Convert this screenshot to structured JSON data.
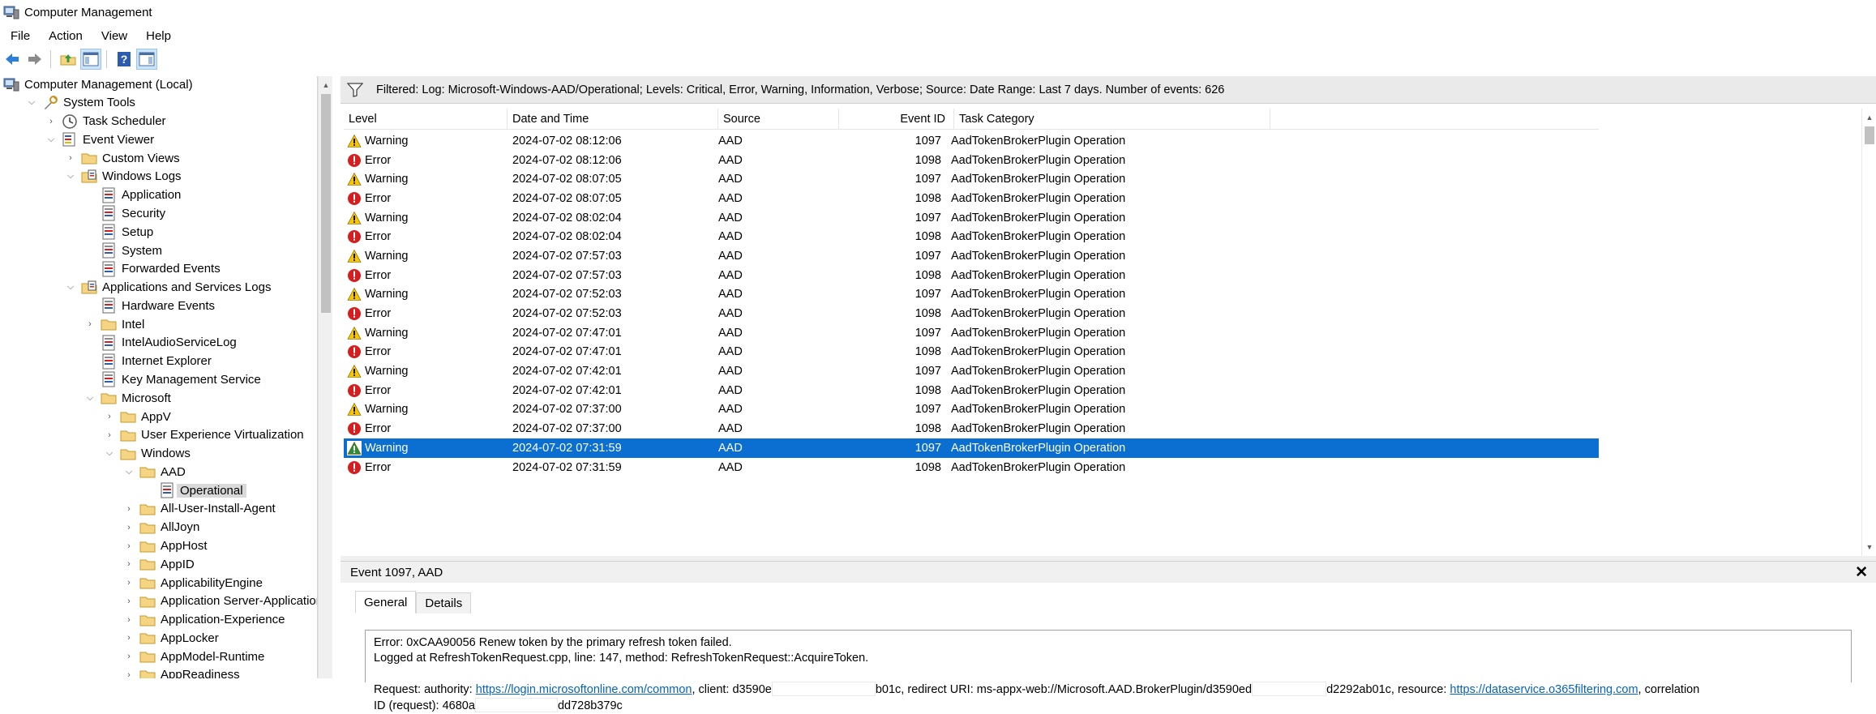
{
  "window": {
    "title": "Computer Management"
  },
  "menu": [
    "File",
    "Action",
    "View",
    "Help"
  ],
  "tree": {
    "items": [
      {
        "label": "Computer Management (Local)",
        "icon": "computer-icon",
        "depth": 0,
        "expander": ""
      },
      {
        "label": "System Tools",
        "icon": "tools-icon",
        "depth": 1,
        "expander": "open"
      },
      {
        "label": "Task Scheduler",
        "icon": "clock-icon",
        "depth": 2,
        "expander": "closed"
      },
      {
        "label": "Event Viewer",
        "icon": "event-viewer-icon",
        "depth": 2,
        "expander": "open"
      },
      {
        "label": "Custom Views",
        "icon": "folder-icon",
        "depth": 3,
        "expander": "closed"
      },
      {
        "label": "Windows Logs",
        "icon": "folder-log-icon",
        "depth": 3,
        "expander": "open"
      },
      {
        "label": "Application",
        "icon": "log-icon",
        "depth": 4,
        "expander": ""
      },
      {
        "label": "Security",
        "icon": "log-icon",
        "depth": 4,
        "expander": ""
      },
      {
        "label": "Setup",
        "icon": "log-icon",
        "depth": 4,
        "expander": ""
      },
      {
        "label": "System",
        "icon": "log-icon",
        "depth": 4,
        "expander": ""
      },
      {
        "label": "Forwarded Events",
        "icon": "log-icon",
        "depth": 4,
        "expander": ""
      },
      {
        "label": "Applications and Services Logs",
        "icon": "folder-log-icon",
        "depth": 3,
        "expander": "open"
      },
      {
        "label": "Hardware Events",
        "icon": "log-icon",
        "depth": 4,
        "expander": ""
      },
      {
        "label": "Intel",
        "icon": "folder-icon",
        "depth": 4,
        "expander": "closed"
      },
      {
        "label": "IntelAudioServiceLog",
        "icon": "log-icon",
        "depth": 4,
        "expander": ""
      },
      {
        "label": "Internet Explorer",
        "icon": "log-icon",
        "depth": 4,
        "expander": ""
      },
      {
        "label": "Key Management Service",
        "icon": "log-icon",
        "depth": 4,
        "expander": ""
      },
      {
        "label": "Microsoft",
        "icon": "folder-icon",
        "depth": 4,
        "expander": "open"
      },
      {
        "label": "AppV",
        "icon": "folder-icon",
        "depth": 5,
        "expander": "closed"
      },
      {
        "label": "User Experience Virtualization",
        "icon": "folder-icon",
        "depth": 5,
        "expander": "closed"
      },
      {
        "label": "Windows",
        "icon": "folder-icon",
        "depth": 5,
        "expander": "open"
      },
      {
        "label": "AAD",
        "icon": "folder-icon",
        "depth": 6,
        "expander": "open"
      },
      {
        "label": "Operational",
        "icon": "log-icon",
        "depth": 7,
        "expander": "",
        "selected": true
      },
      {
        "label": "All-User-Install-Agent",
        "icon": "folder-icon",
        "depth": 6,
        "expander": "closed"
      },
      {
        "label": "AllJoyn",
        "icon": "folder-icon",
        "depth": 6,
        "expander": "closed"
      },
      {
        "label": "AppHost",
        "icon": "folder-icon",
        "depth": 6,
        "expander": "closed"
      },
      {
        "label": "AppID",
        "icon": "folder-icon",
        "depth": 6,
        "expander": "closed"
      },
      {
        "label": "ApplicabilityEngine",
        "icon": "folder-icon",
        "depth": 6,
        "expander": "closed"
      },
      {
        "label": "Application Server-Applications",
        "icon": "folder-icon",
        "depth": 6,
        "expander": "closed"
      },
      {
        "label": "Application-Experience",
        "icon": "folder-icon",
        "depth": 6,
        "expander": "closed"
      },
      {
        "label": "AppLocker",
        "icon": "folder-icon",
        "depth": 6,
        "expander": "closed"
      },
      {
        "label": "AppModel-Runtime",
        "icon": "folder-icon",
        "depth": 6,
        "expander": "closed"
      },
      {
        "label": "AppReadiness",
        "icon": "folder-icon",
        "depth": 6,
        "expander": "closed"
      }
    ]
  },
  "filter": {
    "text": "Filtered: Log: Microsoft-Windows-AAD/Operational; Levels: Critical, Error, Warning, Information, Verbose; Source: Date Range: Last 7 days. Number of events: 626"
  },
  "events": {
    "columns": [
      "Level",
      "Date and Time",
      "Source",
      "Event ID",
      "Task Category"
    ],
    "rows": [
      {
        "level": "Warning",
        "date": "2024-07-02 08:12:06",
        "source": "AAD",
        "id": "1097",
        "category": "AadTokenBrokerPlugin Operation"
      },
      {
        "level": "Error",
        "date": "2024-07-02 08:12:06",
        "source": "AAD",
        "id": "1098",
        "category": "AadTokenBrokerPlugin Operation"
      },
      {
        "level": "Warning",
        "date": "2024-07-02 08:07:05",
        "source": "AAD",
        "id": "1097",
        "category": "AadTokenBrokerPlugin Operation"
      },
      {
        "level": "Error",
        "date": "2024-07-02 08:07:05",
        "source": "AAD",
        "id": "1098",
        "category": "AadTokenBrokerPlugin Operation"
      },
      {
        "level": "Warning",
        "date": "2024-07-02 08:02:04",
        "source": "AAD",
        "id": "1097",
        "category": "AadTokenBrokerPlugin Operation"
      },
      {
        "level": "Error",
        "date": "2024-07-02 08:02:04",
        "source": "AAD",
        "id": "1098",
        "category": "AadTokenBrokerPlugin Operation"
      },
      {
        "level": "Warning",
        "date": "2024-07-02 07:57:03",
        "source": "AAD",
        "id": "1097",
        "category": "AadTokenBrokerPlugin Operation"
      },
      {
        "level": "Error",
        "date": "2024-07-02 07:57:03",
        "source": "AAD",
        "id": "1098",
        "category": "AadTokenBrokerPlugin Operation"
      },
      {
        "level": "Warning",
        "date": "2024-07-02 07:52:03",
        "source": "AAD",
        "id": "1097",
        "category": "AadTokenBrokerPlugin Operation"
      },
      {
        "level": "Error",
        "date": "2024-07-02 07:52:03",
        "source": "AAD",
        "id": "1098",
        "category": "AadTokenBrokerPlugin Operation"
      },
      {
        "level": "Warning",
        "date": "2024-07-02 07:47:01",
        "source": "AAD",
        "id": "1097",
        "category": "AadTokenBrokerPlugin Operation"
      },
      {
        "level": "Error",
        "date": "2024-07-02 07:47:01",
        "source": "AAD",
        "id": "1098",
        "category": "AadTokenBrokerPlugin Operation"
      },
      {
        "level": "Warning",
        "date": "2024-07-02 07:42:01",
        "source": "AAD",
        "id": "1097",
        "category": "AadTokenBrokerPlugin Operation"
      },
      {
        "level": "Error",
        "date": "2024-07-02 07:42:01",
        "source": "AAD",
        "id": "1098",
        "category": "AadTokenBrokerPlugin Operation"
      },
      {
        "level": "Warning",
        "date": "2024-07-02 07:37:00",
        "source": "AAD",
        "id": "1097",
        "category": "AadTokenBrokerPlugin Operation"
      },
      {
        "level": "Error",
        "date": "2024-07-02 07:37:00",
        "source": "AAD",
        "id": "1098",
        "category": "AadTokenBrokerPlugin Operation"
      },
      {
        "level": "Warning",
        "date": "2024-07-02 07:31:59",
        "source": "AAD",
        "id": "1097",
        "category": "AadTokenBrokerPlugin Operation",
        "selected": true
      },
      {
        "level": "Error",
        "date": "2024-07-02 07:31:59",
        "source": "AAD",
        "id": "1098",
        "category": "AadTokenBrokerPlugin Operation"
      }
    ]
  },
  "detail": {
    "title": "Event 1097, AAD",
    "tabs": [
      "General",
      "Details"
    ],
    "line1": "Error: 0xCAA90056 Renew token by the primary refresh token failed.",
    "line2": "Logged at RefreshTokenRequest.cpp, line: 147, method: RefreshTokenRequest::AcquireToken.",
    "req_prefix": "Request: authority: ",
    "authority_link": "https://login.microsoftonline.com/common",
    "client_prefix": ", client: d3590e",
    "client_suffix": "b01c, redirect URI: ms-appx-web://Microsoft.AAD.BrokerPlugin/d3590ed",
    "redirect_suffix": "d2292ab01c, resource: ",
    "resource_link": "https://dataservice.o365filtering.com",
    "corr_prefix": ", correlation",
    "corr_line2_prefix": "ID (request): 4680a",
    "corr_line2_suffix": "dd728b379c"
  },
  "colors": {
    "selection": "#0a6fd1",
    "link": "#0563c1",
    "warning": "#f7c600",
    "error": "#d61e1e"
  }
}
